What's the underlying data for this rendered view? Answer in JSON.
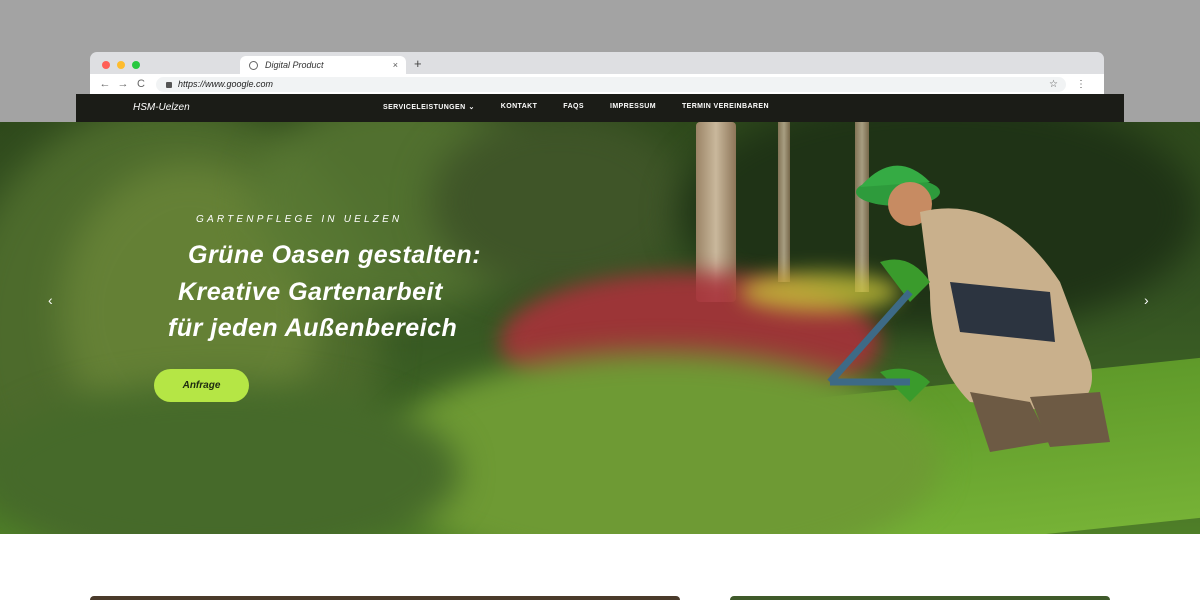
{
  "browser": {
    "tab_title": "Digital Product",
    "tab_close": "×",
    "new_tab": "+",
    "url": "https://www.google.com",
    "back": "←",
    "forward": "→",
    "reload": "C",
    "bookmark": "☆",
    "menu": "⋮"
  },
  "site": {
    "brand": "HSM-Uelzen",
    "menu": [
      {
        "label": "SERVICELEISTUNGEN",
        "has_dropdown": true
      },
      {
        "label": "KONTAKT"
      },
      {
        "label": "FAQS"
      },
      {
        "label": "IMPRESSUM"
      },
      {
        "label": "TERMIN VEREINBAREN"
      }
    ],
    "caret": "⌄"
  },
  "hero": {
    "kicker": "GARTENPFLEGE IN UELZEN",
    "title_lines": [
      "Grüne Oasen gestalten:",
      "Kreative Gartenarbeit",
      "für jeden Außenbereich"
    ],
    "cta_label": "Anfrage",
    "prev": "‹",
    "next": "›"
  },
  "colors": {
    "accent": "#b5e645",
    "nav_bg": "#1b1c17",
    "backdrop": "#a3a3a3"
  }
}
